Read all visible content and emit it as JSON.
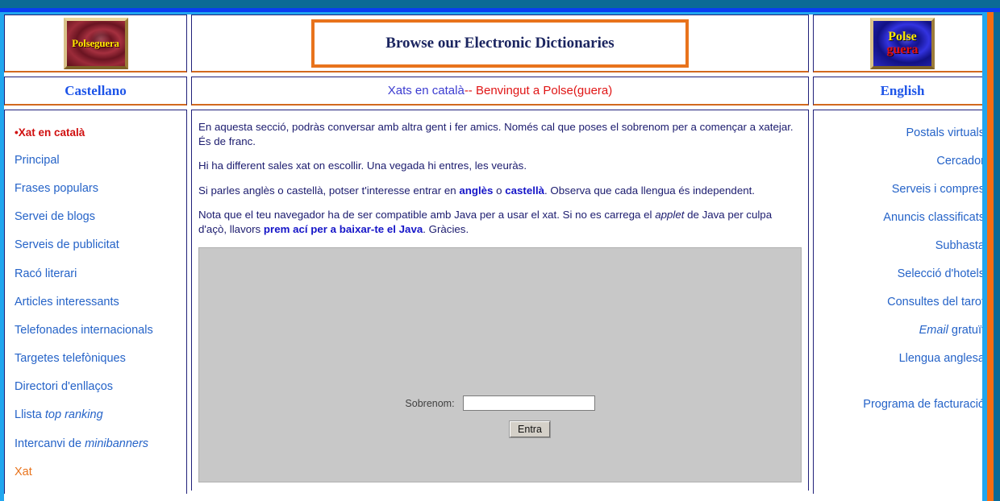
{
  "window": {
    "chrome_colors": {
      "teal": "#0b6a96",
      "blue": "#0a3df0",
      "cyan": "#21a6ef",
      "orange": "#f36d12"
    }
  },
  "header": {
    "logo_left": {
      "text": "Polseguera",
      "alt": "polseguera-logo-red"
    },
    "logo_right": {
      "line1": "Polse",
      "line2": "guera",
      "alt": "polseguera-logo-blue"
    },
    "banner": {
      "text": "Browse our Electronic Dictionaries"
    }
  },
  "lang_bar": {
    "left_label": "Castellano",
    "right_label": "English",
    "page_title_blue": "Xats en català ",
    "page_title_red": "-- Benvingut a Polse(guera)"
  },
  "sidebar_left": {
    "items": [
      {
        "label": "•Xat en català",
        "style": "current"
      },
      {
        "label": "Principal",
        "style": "normal"
      },
      {
        "label": "Frases populars",
        "style": "normal"
      },
      {
        "label": "Servei de blogs",
        "style": "normal"
      },
      {
        "label": "Serveis de publicitat",
        "style": "normal"
      },
      {
        "label": "Racó literari",
        "style": "normal"
      },
      {
        "label": "Articles interessants",
        "style": "normal"
      },
      {
        "label": "Telefonades internacionals",
        "style": "normal"
      },
      {
        "label": "Targetes telefòniques",
        "style": "normal"
      },
      {
        "label": "Directori d'enllaços",
        "style": "normal"
      },
      {
        "label": "Llista top ranking",
        "style": "italic-tail",
        "plain": "Llista ",
        "italic": "top ranking"
      },
      {
        "label": "Intercanvi de minibanners",
        "style": "italic-tail",
        "plain": "Intercanvi de ",
        "italic": "minibanners"
      },
      {
        "label": "Xat",
        "style": "alt"
      }
    ]
  },
  "sidebar_right": {
    "items": [
      {
        "label": "Postals virtuals"
      },
      {
        "label": "Cercador"
      },
      {
        "label": "Serveis i compres"
      },
      {
        "label": "Anuncis classificats"
      },
      {
        "label": "Subhasta"
      },
      {
        "label": "Selecció d'hotels"
      },
      {
        "label": "Consultes del tarot"
      },
      {
        "label": "Email gratuït",
        "italic": "Email",
        "plain": " gratuït"
      },
      {
        "label": "Llengua anglesa"
      },
      {
        "label": "Programa de facturació",
        "gap": true
      }
    ]
  },
  "main": {
    "p1": "En aquesta secció, podràs conversar amb altra gent i fer amics. Només cal que poses el sobrenom per a començar a xatejar. És de franc.",
    "p2": "Hi ha different sales xat on escollir. Una vegada hi entres, les veuràs.",
    "p3_a": "Si parles anglès o castellà, potser t'interesse entrar en ",
    "p3_link1": "anglès",
    "p3_b": " o ",
    "p3_link2": "castellà",
    "p3_c": ". Observa que cada llengua és independent.",
    "p4_a": "Nota que el teu navegador ha de ser compatible amb Java per a usar el xat. Si no es carrega el ",
    "p4_em": "applet",
    "p4_b": " de Java per culpa d'açò, llavors ",
    "p4_link": "prem ací per a baixar-te el Java",
    "p4_c": ". Gràcies."
  },
  "applet": {
    "nickname_label": "Sobrenom:",
    "nickname_value": "",
    "nickname_placeholder": "",
    "enter_button": "Entra"
  }
}
